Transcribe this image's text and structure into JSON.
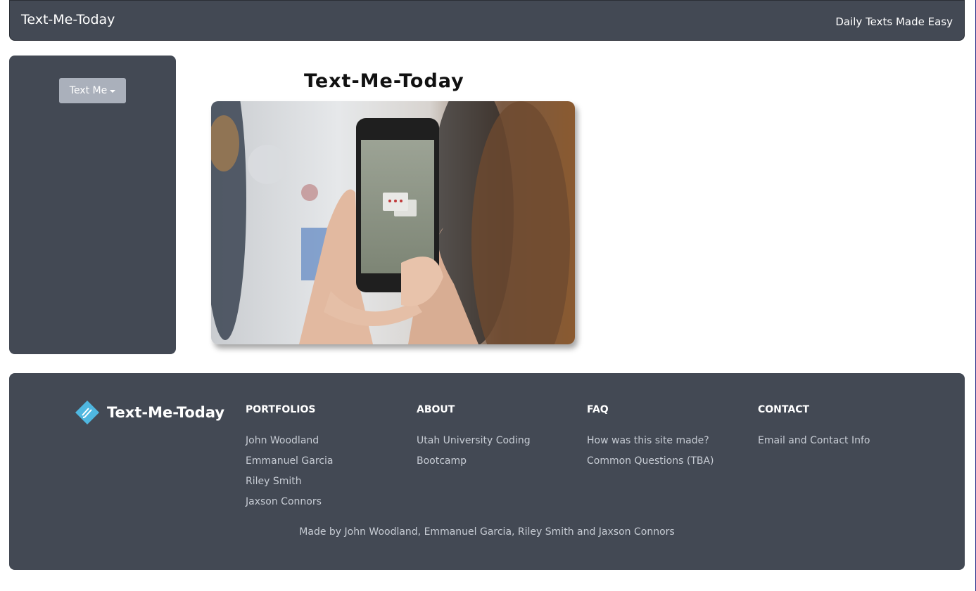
{
  "header": {
    "brand": "Text-Me-Today",
    "tagline": "Daily Texts Made Easy"
  },
  "sidebar": {
    "button_label": "Text Me",
    "button_icon": "caret-down-icon"
  },
  "main": {
    "title": "Text-Me-Today"
  },
  "footer": {
    "brand": "Text-Me-Today",
    "logo_icon": "diamond-logo-icon",
    "columns": {
      "portfolios": {
        "heading": "PORTFOLIOS",
        "links": [
          "John Woodland",
          "Emmanuel Garcia",
          "Riley Smith",
          "Jaxson Connors"
        ]
      },
      "about": {
        "heading": "ABOUT",
        "links": [
          "Utah University Coding",
          "Bootcamp"
        ]
      },
      "faq": {
        "heading": "FAQ",
        "links": [
          "How was this site made?",
          "Common Questions (TBA)"
        ]
      },
      "contact": {
        "heading": "CONTACT",
        "links": [
          "Email and Contact Info"
        ]
      }
    },
    "credits": "Made by John Woodland, Emmanuel Garcia, Riley Smith and Jaxson Connors"
  },
  "colors": {
    "panel": "#434954",
    "button": "#aab0bb",
    "logo_accent": "#4fb7e0"
  }
}
